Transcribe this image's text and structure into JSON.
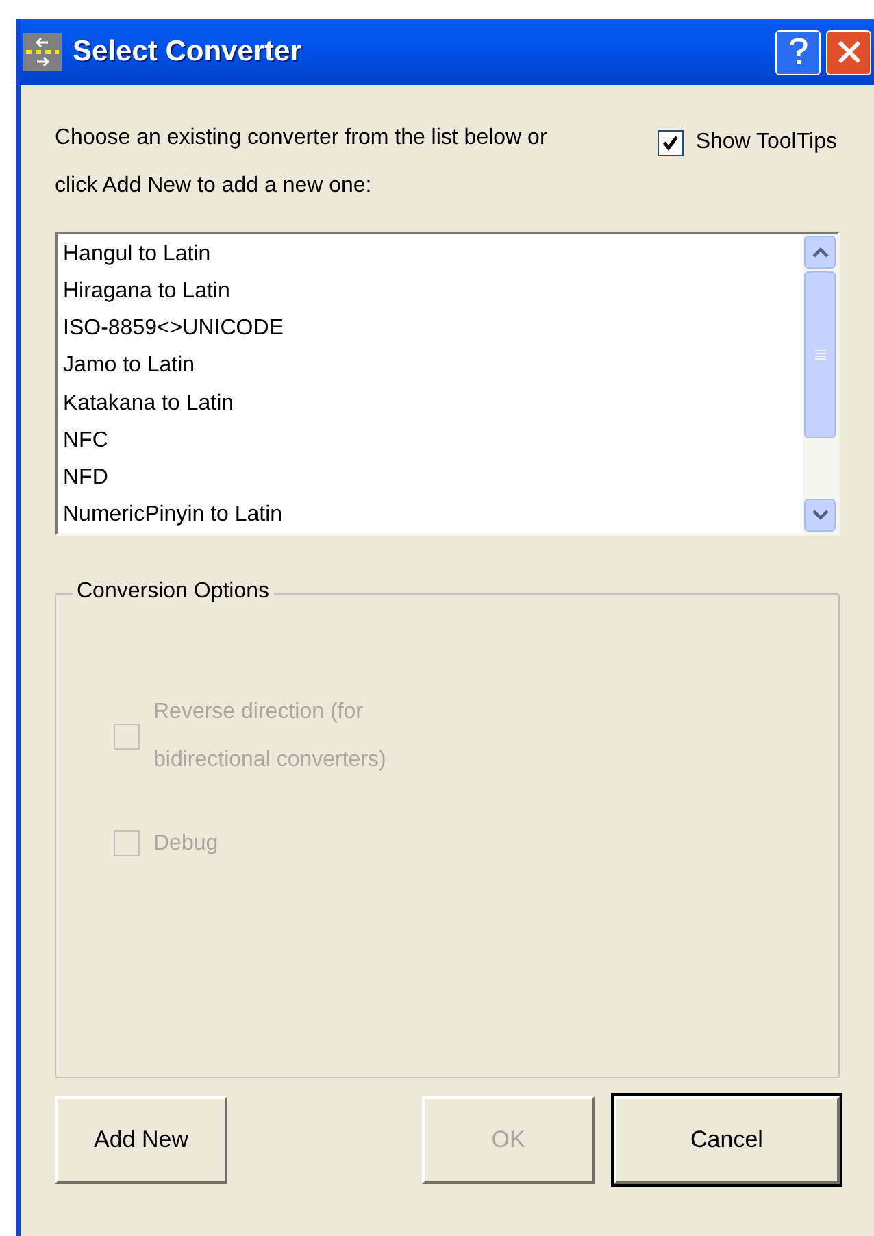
{
  "window": {
    "title": "Select Converter"
  },
  "instruction": "Choose an existing converter from the list below or click Add New to add a new one:",
  "show_tooltips": {
    "label": "Show ToolTips",
    "checked": true
  },
  "converters": [
    {
      "label": "Hangul to Latin",
      "selected": false
    },
    {
      "label": "Hiragana to Latin",
      "selected": false
    },
    {
      "label": "ISO-8859<>UNICODE",
      "selected": false
    },
    {
      "label": "Jamo to Latin",
      "selected": false
    },
    {
      "label": "Katakana to Latin",
      "selected": false
    },
    {
      "label": "NFC",
      "selected": false
    },
    {
      "label": "NFD",
      "selected": false
    },
    {
      "label": "NumericPinyin to Latin",
      "selected": false
    }
  ],
  "conversion_options": {
    "title": "Conversion Options",
    "options": [
      {
        "label": "Reverse direction (for bidirectional converters)",
        "checked": false,
        "disabled": true
      },
      {
        "label": "Debug",
        "checked": false,
        "disabled": true
      }
    ]
  },
  "buttons": [
    {
      "label": "Add New",
      "disabled": false,
      "default": false
    },
    {
      "label": "OK",
      "disabled": true,
      "default": false
    },
    {
      "label": "Cancel",
      "disabled": false,
      "default": true
    }
  ]
}
